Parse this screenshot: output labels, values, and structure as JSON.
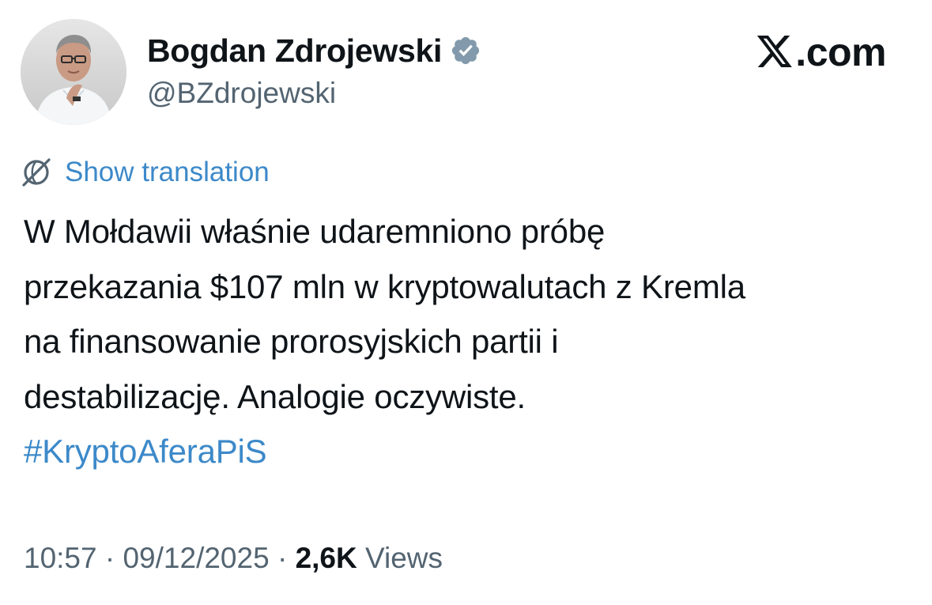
{
  "author": {
    "display_name": "Bogdan Zdrojewski",
    "handle": "@BZdrojewski",
    "verified": true
  },
  "brand": {
    "label": ".com",
    "icon": "x-logo-icon"
  },
  "translate": {
    "icon": "globe-icon",
    "label": "Show translation"
  },
  "tweet": {
    "lines": [
      "W Mołdawii właśnie udaremniono próbę",
      "przekazania $107 mln w kryptowalutach z Kremla",
      "na finansowanie prorosyjskich partii i",
      "destabilizację. Analogie oczywiste."
    ],
    "hashtag": "#KryptoAferaPiS"
  },
  "meta": {
    "time": "10:57",
    "separator": "·",
    "date": "09/12/2025",
    "views_count": "2,6K",
    "views_label": "Views"
  },
  "colors": {
    "link": "#3c89c9",
    "text": "#0f1419",
    "secondary": "#536471",
    "verified_badge": "#829aab"
  }
}
